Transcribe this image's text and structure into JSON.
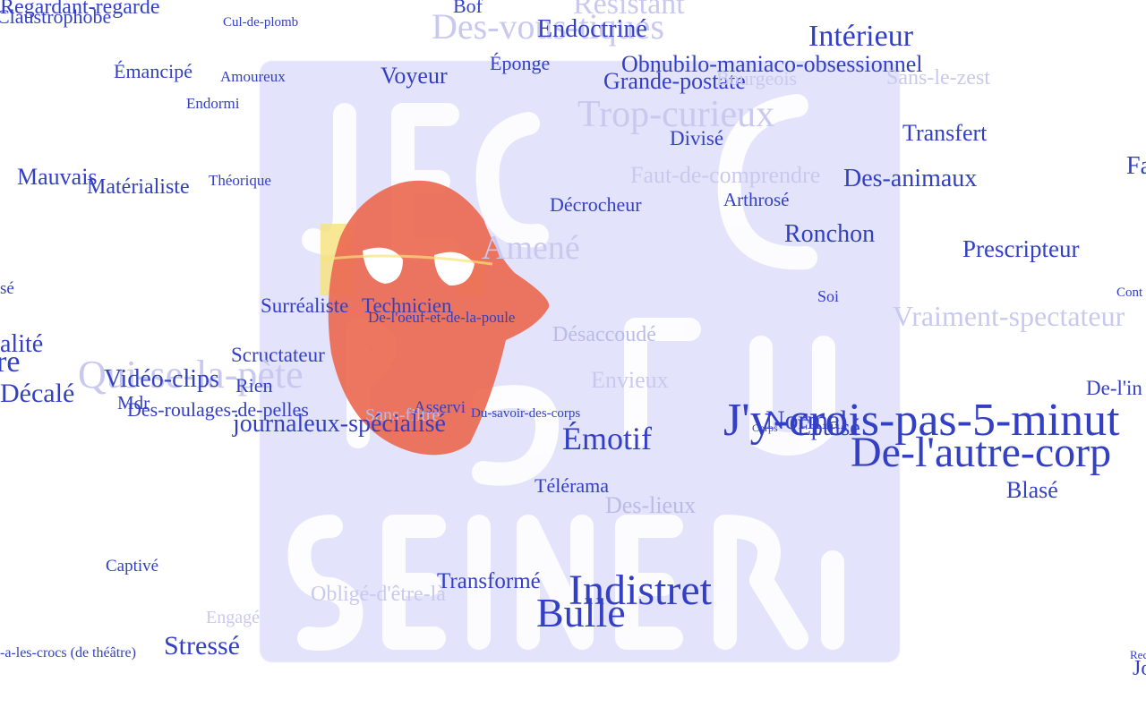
{
  "colors": {
    "word": "#3340c4",
    "word_faded": "#c9c9ef",
    "poster_bg": "#e3e3fb",
    "poster_letters": "#ffffff",
    "mask": "#ec6a52",
    "mask_highlight": "#f6e27a"
  },
  "poster": {
    "icon": "theatre-mask-poster",
    "letters": "JE ME SPECTATEUR"
  },
  "words": [
    {
      "text": "Regardant-regarde",
      "name": "word-regardant-regarde"
    },
    {
      "text": "Claustrophobe",
      "name": "word-claustrophobe"
    },
    {
      "text": "Cul-de-plomb",
      "name": "word-cul-de-plomb"
    },
    {
      "text": "Bof",
      "name": "word-bof"
    },
    {
      "text": "Résistant",
      "name": "word-resistant"
    },
    {
      "text": "Des-vous-tiques",
      "name": "word-des-vous-tiques"
    },
    {
      "text": "Endoctriné",
      "name": "word-endoctrine"
    },
    {
      "text": "Intérieur",
      "name": "word-interieur"
    },
    {
      "text": "Émancipé",
      "name": "word-emancipe"
    },
    {
      "text": "Amoureux",
      "name": "word-amoureux"
    },
    {
      "text": "Voyeur",
      "name": "word-voyeur"
    },
    {
      "text": "Éponge",
      "name": "word-eponge"
    },
    {
      "text": "Obnubilo-maniaco-obsessionnel",
      "name": "word-obnubilo"
    },
    {
      "text": "Grande-postate",
      "name": "word-grande-postate"
    },
    {
      "text": "Bourgeois",
      "name": "word-bourgeois"
    },
    {
      "text": "Sans-le-zest",
      "name": "word-sans-le-zest"
    },
    {
      "text": "Endormi",
      "name": "word-endormi"
    },
    {
      "text": "Trop-curieux",
      "name": "word-trop-curieux"
    },
    {
      "text": "Divisé",
      "name": "word-divise"
    },
    {
      "text": "Transfert",
      "name": "word-transfert"
    },
    {
      "text": "Mauvais",
      "name": "word-mauvais"
    },
    {
      "text": "Matérialiste",
      "name": "word-materialiste"
    },
    {
      "text": "Théorique",
      "name": "word-theorique"
    },
    {
      "text": "Faut-de-comprendre",
      "name": "word-faut-de-comprendre"
    },
    {
      "text": "Des-animaux",
      "name": "word-des-animaux"
    },
    {
      "text": "Fa",
      "name": "word-fa"
    },
    {
      "text": "Décrocheur",
      "name": "word-decrocheur"
    },
    {
      "text": "Arthrosé",
      "name": "word-arthrose"
    },
    {
      "text": "Ronchon",
      "name": "word-ronchon"
    },
    {
      "text": "Amené",
      "name": "word-amene"
    },
    {
      "text": "Prescripteur",
      "name": "word-prescripteur"
    },
    {
      "text": "sé",
      "name": "word-se"
    },
    {
      "text": "Soi",
      "name": "word-soi"
    },
    {
      "text": "Cont",
      "name": "word-cont"
    },
    {
      "text": "Surréaliste",
      "name": "word-surrealiste"
    },
    {
      "text": "Technicien",
      "name": "word-technicien"
    },
    {
      "text": "De-l'oeuf-et-de-la-poule",
      "name": "word-de-loeuf"
    },
    {
      "text": "Vraiment-spectateur",
      "name": "word-vraiment-spectateur"
    },
    {
      "text": "Désaccoudé",
      "name": "word-desaccoude"
    },
    {
      "text": "alité",
      "name": "word-alite"
    },
    {
      "text": "re",
      "name": "word-re"
    },
    {
      "text": "Scructateur",
      "name": "word-scructateur"
    },
    {
      "text": "Qui-se-la-pète",
      "name": "word-qui-se-la-pete"
    },
    {
      "text": "Vidéo-clips",
      "name": "word-video-clips"
    },
    {
      "text": "Envieux",
      "name": "word-envieux"
    },
    {
      "text": "Rien",
      "name": "word-rien"
    },
    {
      "text": "De-l'in",
      "name": "word-de-lin"
    },
    {
      "text": "Décalé",
      "name": "word-decale"
    },
    {
      "text": "Mdr",
      "name": "word-mdr"
    },
    {
      "text": "Des-roulages-de-pelles",
      "name": "word-des-roulages"
    },
    {
      "text": "Asservi",
      "name": "word-asservi"
    },
    {
      "text": "Sans-filtre",
      "name": "word-sans-filtre"
    },
    {
      "text": "Du-savoir-des-corps",
      "name": "word-du-savoir"
    },
    {
      "text": "J'y-crois-pas-5-minut",
      "name": "word-jy-crois"
    },
    {
      "text": "Normal",
      "name": "word-normal"
    },
    {
      "text": "Épuisé",
      "name": "word-epuise"
    },
    {
      "text": "Corps",
      "name": "word-corps"
    },
    {
      "text": "journaleux-spécialisé",
      "name": "word-journaleux"
    },
    {
      "text": "Émotif",
      "name": "word-emotif"
    },
    {
      "text": "De-l'autre-corp",
      "name": "word-de-lautre-corp"
    },
    {
      "text": "Télérama",
      "name": "word-telerama"
    },
    {
      "text": "Blasé",
      "name": "word-blase"
    },
    {
      "text": "Des-lieux",
      "name": "word-des-lieux"
    },
    {
      "text": "Captivé",
      "name": "word-captive"
    },
    {
      "text": "Transformé",
      "name": "word-transforme"
    },
    {
      "text": "Indistret",
      "name": "word-indistret"
    },
    {
      "text": "Obligé-d'être-là",
      "name": "word-oblige"
    },
    {
      "text": "Bulle",
      "name": "word-bulle"
    },
    {
      "text": "Engagé",
      "name": "word-engage"
    },
    {
      "text": "Stressé",
      "name": "word-stresse"
    },
    {
      "text": "-a-les-crocs (de théâtre)",
      "name": "word-a-les-crocs"
    },
    {
      "text": "Rec",
      "name": "word-rec"
    },
    {
      "text": "Jo",
      "name": "word-jo"
    }
  ]
}
